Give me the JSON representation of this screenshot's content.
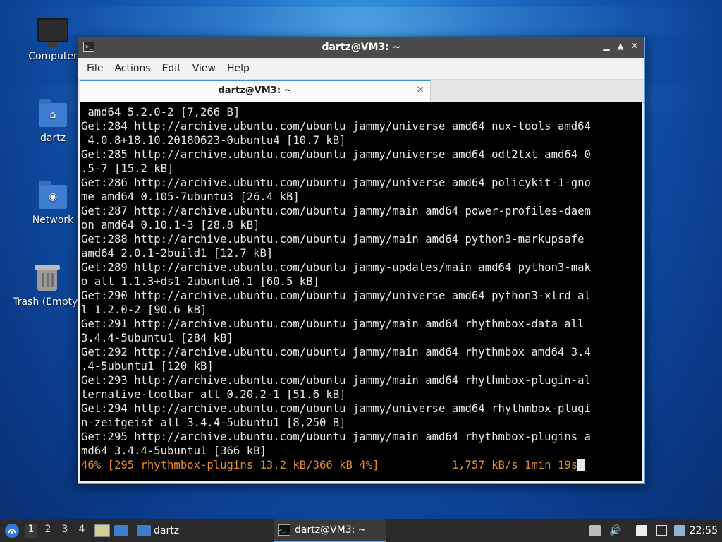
{
  "desktop": {
    "icons": [
      {
        "label": "Computer"
      },
      {
        "label": "dartz"
      },
      {
        "label": "Network"
      },
      {
        "label": "Trash (Empty)"
      }
    ]
  },
  "window": {
    "title": "dartz@VM3: ~",
    "menu": [
      "File",
      "Actions",
      "Edit",
      "View",
      "Help"
    ],
    "tab": {
      "label": "dartz@VM3: ~",
      "close": "×"
    },
    "controls": {
      "minimize": "▁",
      "maximize": "▲",
      "close": "✕"
    }
  },
  "terminal": {
    "lines": [
      " amd64 5.2.0-2 [7,266 B]",
      "Get:284 http://archive.ubuntu.com/ubuntu jammy/universe amd64 nux-tools amd64",
      " 4.0.8+18.10.20180623-0ubuntu4 [10.7 kB]",
      "Get:285 http://archive.ubuntu.com/ubuntu jammy/universe amd64 odt2txt amd64 0",
      ".5-7 [15.2 kB]",
      "Get:286 http://archive.ubuntu.com/ubuntu jammy/universe amd64 policykit-1-gno",
      "me amd64 0.105-7ubuntu3 [26.4 kB]",
      "Get:287 http://archive.ubuntu.com/ubuntu jammy/main amd64 power-profiles-daem",
      "on amd64 0.10.1-3 [28.8 kB]",
      "Get:288 http://archive.ubuntu.com/ubuntu jammy/main amd64 python3-markupsafe",
      "amd64 2.0.1-2build1 [12.7 kB]",
      "Get:289 http://archive.ubuntu.com/ubuntu jammy-updates/main amd64 python3-mak",
      "o all 1.1.3+ds1-2ubuntu0.1 [60.5 kB]",
      "Get:290 http://archive.ubuntu.com/ubuntu jammy/universe amd64 python3-xlrd al",
      "l 1.2.0-2 [90.6 kB]",
      "Get:291 http://archive.ubuntu.com/ubuntu jammy/main amd64 rhythmbox-data all",
      "3.4.4-5ubuntu1 [284 kB]",
      "Get:292 http://archive.ubuntu.com/ubuntu jammy/main amd64 rhythmbox amd64 3.4",
      ".4-5ubuntu1 [120 kB]",
      "Get:293 http://archive.ubuntu.com/ubuntu jammy/main amd64 rhythmbox-plugin-al",
      "ternative-toolbar all 0.20.2-1 [51.6 kB]",
      "Get:294 http://archive.ubuntu.com/ubuntu jammy/universe amd64 rhythmbox-plugi",
      "n-zeitgeist all 3.4.4-5ubuntu1 [8,250 B]",
      "Get:295 http://archive.ubuntu.com/ubuntu jammy/main amd64 rhythmbox-plugins a",
      "md64 3.4.4-5ubuntu1 [366 kB]"
    ],
    "progress_line": "46% [295 rhythmbox-plugins 13.2 kB/366 kB 4%]           1,757 kB/s 1min 19s",
    "colors": {
      "background": "#000000",
      "text": "#e8e8e8",
      "progress": "#e08a2f"
    }
  },
  "taskbar": {
    "workspaces": [
      "1",
      "2",
      "3",
      "4"
    ],
    "active_workspace": "1",
    "folder_button": "dartz",
    "window_button": "dartz@VM3: ~",
    "clock": "22:55",
    "tray_icons": [
      "updates-icon",
      "volume-icon",
      "clipboard-icon",
      "display-icon",
      "network-icon"
    ]
  }
}
